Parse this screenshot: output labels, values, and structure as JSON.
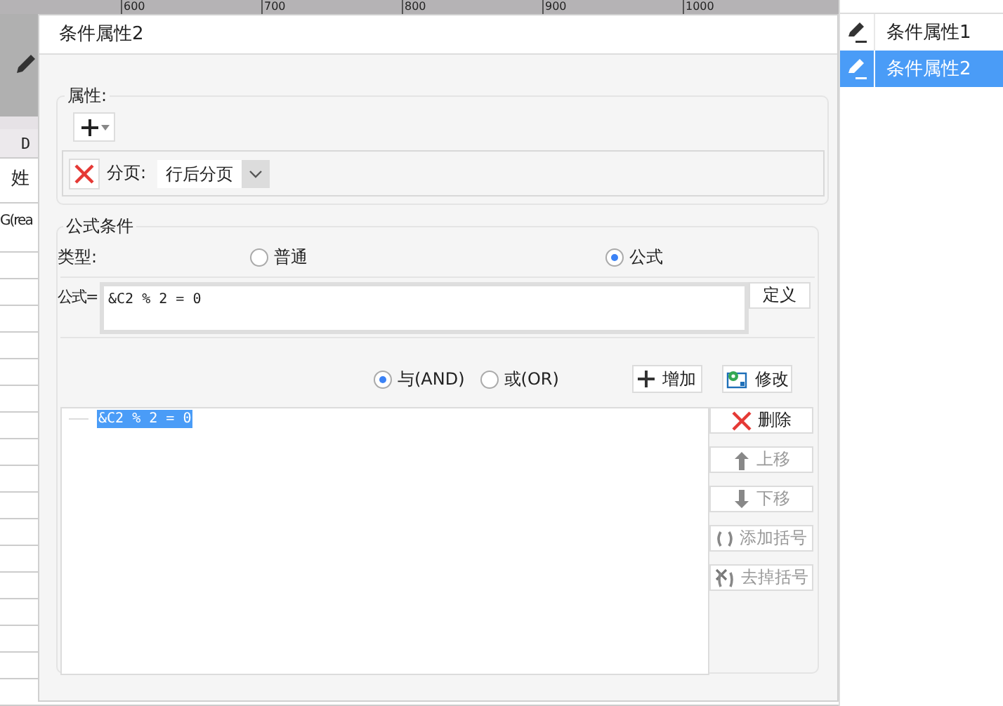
{
  "ruler": {
    "labels": [
      "600",
      "700",
      "800",
      "900",
      "1000"
    ]
  },
  "sheet": {
    "column_header": "D",
    "cells": [
      "姓",
      "G(rea"
    ]
  },
  "side_panel": {
    "items": [
      {
        "label": "条件属性1",
        "selected": false
      },
      {
        "label": "条件属性2",
        "selected": true
      }
    ]
  },
  "dialog": {
    "title": "条件属性2",
    "properties": {
      "legend": "属性:",
      "rows": [
        {
          "label": "分页:",
          "value": "行后分页"
        }
      ]
    },
    "formula_condition": {
      "legend": "公式条件",
      "type_label": "类型:",
      "type_options": [
        {
          "label": "普通",
          "selected": false
        },
        {
          "label": "公式",
          "selected": true
        }
      ],
      "formula_label": "公式=",
      "formula_value": "&C2 % 2 = 0",
      "define_button": "定义",
      "join_options": [
        {
          "label": "与(AND)",
          "selected": true
        },
        {
          "label": "或(OR)",
          "selected": false
        }
      ],
      "add_button": "增加",
      "modify_button": "修改",
      "conditions": [
        {
          "text": "&C2 % 2 = 0",
          "selected": true
        }
      ],
      "actions": [
        {
          "kind": "delete",
          "label": "删除",
          "disabled": false
        },
        {
          "kind": "up",
          "label": "上移",
          "disabled": true
        },
        {
          "kind": "down",
          "label": "下移",
          "disabled": true
        },
        {
          "kind": "add_paren",
          "label": "添加括号",
          "disabled": true
        },
        {
          "kind": "remove_paren",
          "label": "去掉括号",
          "disabled": true
        }
      ]
    }
  }
}
